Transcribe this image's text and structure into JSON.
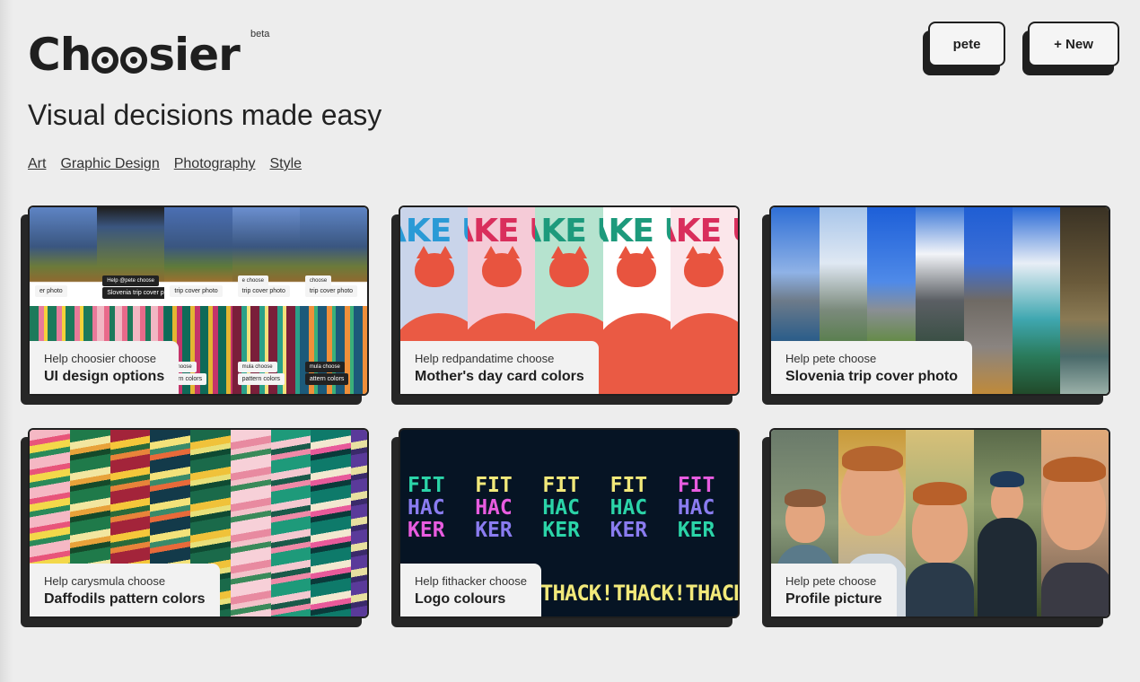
{
  "brand": {
    "name_prefix": "Ch",
    "name_suffix": "sier",
    "badge": "beta"
  },
  "tagline": "Visual decisions made easy",
  "categories": [
    "Art",
    "Graphic Design",
    "Photography",
    "Style"
  ],
  "header_buttons": {
    "user": "pete",
    "new": "+ New"
  },
  "cards": [
    {
      "subtitle": "Help choosier choose",
      "title": "UI design options",
      "thumb_tags": [
        "er photo",
        "Help @pete choose",
        "Slovenia trip cover photo",
        "trip cover photo",
        "trip cover photo",
        "e choose",
        "trip cover photo",
        "choose",
        "pattern colors",
        "mula choose",
        "choose",
        "ern colors",
        "mula choose",
        "attern colors"
      ]
    },
    {
      "subtitle": "Help redpandatime choose",
      "title": "Mother's day card colors",
      "thumb_text": "AKE U"
    },
    {
      "subtitle": "Help pete choose",
      "title": "Slovenia trip cover photo"
    },
    {
      "subtitle": "Help carysmula choose",
      "title": "Daffodils pattern colors"
    },
    {
      "subtitle": "Help fithacker choose",
      "title": "Logo colours",
      "thumb_words": [
        "FIT",
        "HAC",
        "KER"
      ],
      "thumb_banner": "THACK!THACK!THACK"
    },
    {
      "subtitle": "Help pete choose",
      "title": "Profile picture"
    }
  ],
  "colors": {
    "background": "#ededed",
    "ink": "#1f1f1f",
    "fit_variants": [
      [
        "#2bd4a8",
        "#8a7cf0",
        "#e85ce0"
      ],
      [
        "#f2e97a",
        "#e85ce0",
        "#8a7cf0"
      ],
      [
        "#f2e97a",
        "#2bd4a8",
        "#2bd4a8"
      ],
      [
        "#f2e97a",
        "#2bd4a8",
        "#8a7cf0"
      ],
      [
        "#e85ce0",
        "#8a7cf0",
        "#2bd4a8"
      ]
    ],
    "panda_variants": [
      [
        "#c9d4ea",
        "#2a9ad6"
      ],
      [
        "#f5cbd7",
        "#d92e5c"
      ],
      [
        "#b6e3cf",
        "#1d9a7c"
      ],
      [
        "#ffffff",
        "#1d9a7c"
      ],
      [
        "#fbe6ea",
        "#d92e5c"
      ]
    ]
  }
}
